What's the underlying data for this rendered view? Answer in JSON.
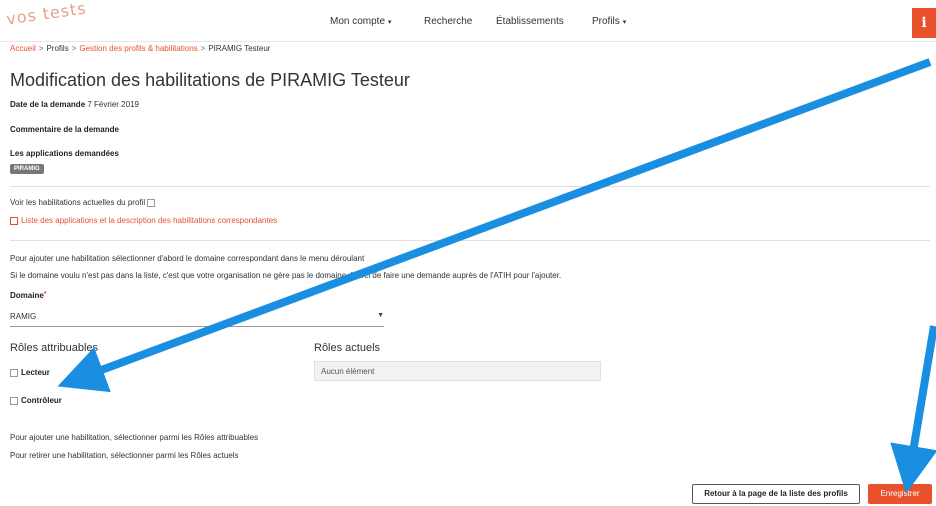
{
  "header": {
    "logo_text": "vos tests",
    "nav": [
      {
        "label": "Mon compte",
        "has_caret": true
      },
      {
        "label": "Recherche",
        "has_caret": false
      },
      {
        "label": "Établissements",
        "has_caret": false
      },
      {
        "label": "Profils",
        "has_caret": true
      }
    ],
    "info_label": "i"
  },
  "breadcrumb": {
    "home": "Accueil",
    "profils": "Profils",
    "gestion": "Gestion des profils & habilitations",
    "current": "PIRAMIG Testeur"
  },
  "page": {
    "title": "Modification des habilitations de PIRAMIG Testeur",
    "date_label": "Date de la demande",
    "date_value": "7 Février 2019",
    "comment_label": "Commentaire de la demande",
    "apps_label": "Les applications demandées",
    "app_badge": "PIRAMIG",
    "see_current_label": "Voir les habilitations actuelles du profil",
    "apps_link": "Liste des applications et la description des habilitations correspondantes",
    "help_domain": "Pour ajouter une habilitation sélectionner d'abord le domaine correspondant dans le menu déroulant",
    "help_not_listed": "Si le domaine voulu n'est pas dans la liste, c'est que votre organisation ne gère pas le domaine. Merci de faire une demande auprès de l'ATIH pour l'ajouter.",
    "domain_label": "Domaine",
    "domain_required": "*",
    "domain_value": "RAMIG",
    "roles_available_title": "Rôles attribuables",
    "roles_current_title": "Rôles actuels",
    "roles_available": [
      "Lecteur",
      "Contrôleur"
    ],
    "roles_current_empty": "Aucun élément",
    "help_add": "Pour ajouter une habilitation, sélectionner parmi les Rôles attribuables",
    "help_remove": "Pour retirer une habilitation, sélectionner parmi les Rôles actuels"
  },
  "actions": {
    "back_label": "Retour à la page de la liste des profils",
    "save_label": "Enregistrer"
  },
  "colors": {
    "accent": "#e8512c",
    "annotation_arrow": "#1a8ee0"
  }
}
